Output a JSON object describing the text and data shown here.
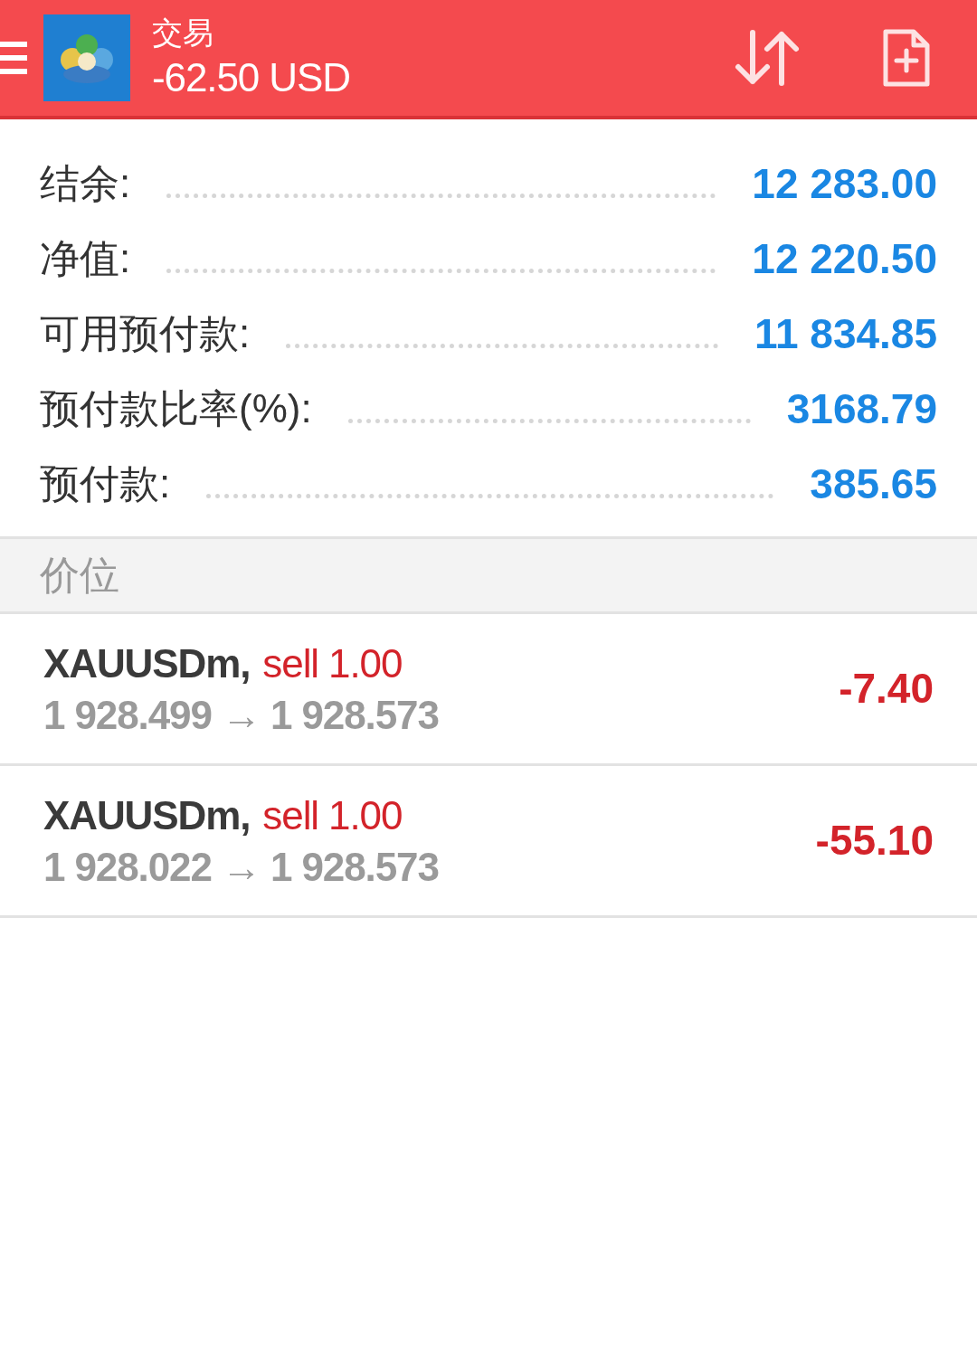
{
  "header": {
    "title": "交易",
    "profit": "-62.50 USD"
  },
  "summary": [
    {
      "label": "结余:",
      "value": "12 283.00"
    },
    {
      "label": "净值:",
      "value": "12 220.50"
    },
    {
      "label": "可用预付款:",
      "value": "11 834.85"
    },
    {
      "label": "预付款比率(%):",
      "value": "3168.79"
    },
    {
      "label": "预付款:",
      "value": "385.65"
    }
  ],
  "section": {
    "title": "价位"
  },
  "positions": [
    {
      "symbol": "XAUUSDm,",
      "order": "sell 1.00",
      "prices": "1 928.499 → 1 928.573",
      "profit": "-7.40"
    },
    {
      "symbol": "XAUUSDm,",
      "order": "sell 1.00",
      "prices": "1 928.022 → 1 928.573",
      "profit": "-55.10"
    }
  ]
}
